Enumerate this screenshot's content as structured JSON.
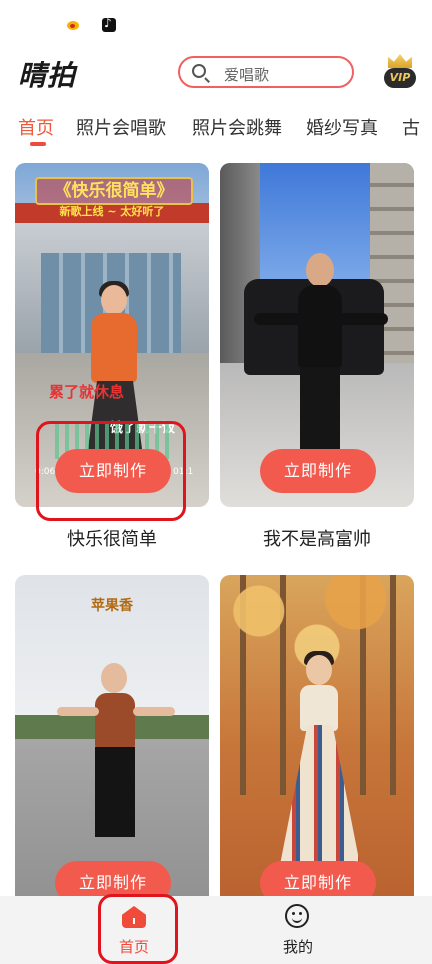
{
  "header": {
    "app_name": "晴拍",
    "search_placeholder": "爱唱歌",
    "vip_label": "VIP"
  },
  "tabs": [
    "首页",
    "照片会唱歌",
    "照片会跳舞",
    "婚纱写真",
    "古"
  ],
  "cards": [
    {
      "title": "快乐很简单",
      "button": "立即制作",
      "overlay_title": "《快乐很简单》",
      "overlay_sub": "新歌上线 ~ 太好听了",
      "lyric1": "累了就休息",
      "lyric2": "饿了就干饭",
      "time_start": "0:06",
      "time_end": "01:1"
    },
    {
      "title": "我不是高富帅",
      "button": "立即制作"
    },
    {
      "overlay_title": "苹果香",
      "button": "立即制作"
    },
    {
      "button": "立即制作"
    }
  ],
  "bottom_nav": {
    "home": "首页",
    "mine": "我的"
  },
  "colors": {
    "accent": "#ef4a3a",
    "button": "#f25a4d",
    "annotation": "#e0141c"
  }
}
